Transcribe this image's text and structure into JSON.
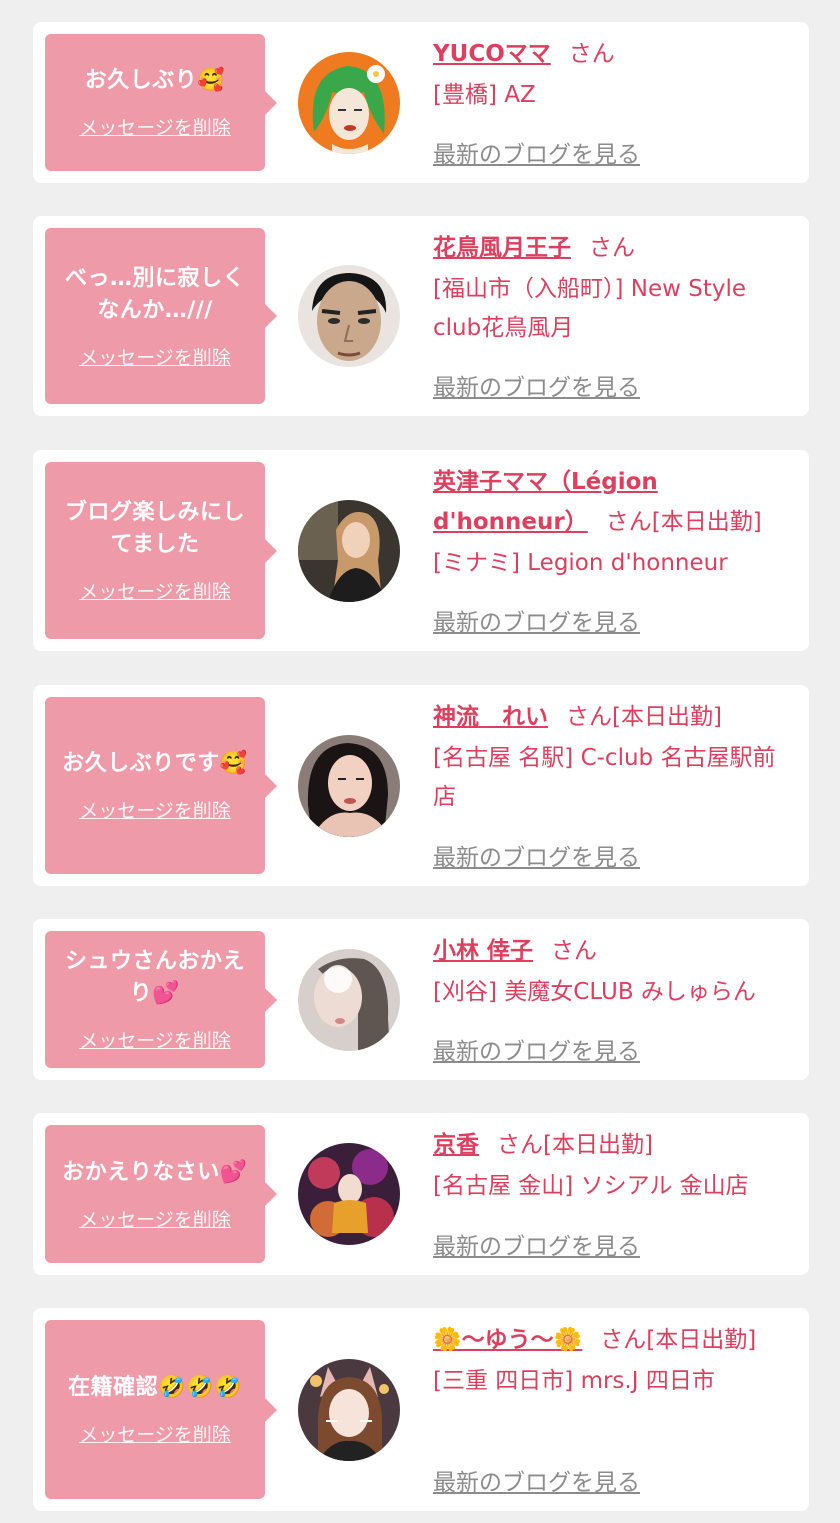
{
  "delete_label": "メッセージを削除",
  "blog_label": "最新のブログを見る",
  "honorific": "さん",
  "colors": {
    "accent": "#de3f5e",
    "bubble": "#ef9aa8",
    "link_gray": "#8c8c8c",
    "background": "#efefef"
  },
  "messages": [
    {
      "text": "お久しぶり🥰",
      "name": "YUCOママ",
      "suffix": "さん",
      "shop": "[豊橋] AZ",
      "avatar_icon": "illustrated-green-hair-avatar"
    },
    {
      "text": "べっ…別に寂しくなんか…///",
      "name": "花鳥風月王子",
      "suffix": "さん",
      "shop": "[福山市（入船町）] New Style club花鳥風月",
      "avatar_icon": "man-face-avatar"
    },
    {
      "text": "ブログ楽しみにしてました",
      "name": "英津子ママ（Légion d'honneur）",
      "suffix": "さん[本日出勤]",
      "shop": "[ミナミ] Legion d'honneur",
      "avatar_icon": "woman-photo-avatar"
    },
    {
      "text": "お久しぶりです🥰",
      "name": "神流　れい",
      "suffix": "さん[本日出勤]",
      "shop": "[名古屋 名駅] C-club 名古屋駅前店",
      "avatar_icon": "woman-photo-avatar"
    },
    {
      "text": "シュウさんおかえり💕",
      "name": "小林 倖子",
      "suffix": "さん",
      "shop": "[刈谷] 美魔女CLUB みしゅらん",
      "avatar_icon": "woman-photo-avatar"
    },
    {
      "text": "おかえりなさい💕",
      "name": "京香",
      "suffix": "さん[本日出勤]",
      "shop": "[名古屋 金山] ソシアル 金山店",
      "avatar_icon": "kimono-photo-avatar"
    },
    {
      "text": "在籍確認🤣🤣🤣",
      "name": "🌼〜ゆう〜🌼",
      "suffix": "さん[本日出勤]",
      "shop": "[三重 四日市] mrs.J 四日市",
      "avatar_icon": "woman-cat-filter-avatar"
    }
  ]
}
